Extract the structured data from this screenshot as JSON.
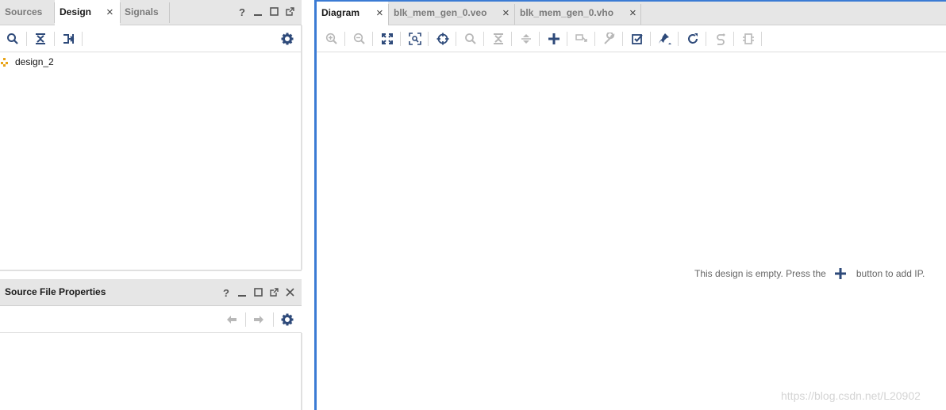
{
  "left_panel": {
    "tabs": [
      {
        "label": "Sources"
      },
      {
        "label": "Design"
      },
      {
        "label": "Signals"
      }
    ],
    "tree": {
      "root_label": "design_2"
    }
  },
  "properties_panel": {
    "title": "Source File Properties"
  },
  "diagram_panel": {
    "tabs": [
      {
        "label": "Diagram"
      },
      {
        "label": "blk_mem_gen_0.veo"
      },
      {
        "label": "blk_mem_gen_0.vho"
      }
    ],
    "empty_message_before": "This design is empty. Press the",
    "empty_message_after": "button to add IP."
  },
  "symbols": {
    "help": "?",
    "close": "×"
  },
  "watermark": "https://blog.csdn.net/L20902",
  "colors": {
    "accent": "#3b7bd4",
    "icon_blue": "#2e4a7a",
    "icon_disabled": "#b8b8b8",
    "tree_icon": "#e8a317"
  }
}
